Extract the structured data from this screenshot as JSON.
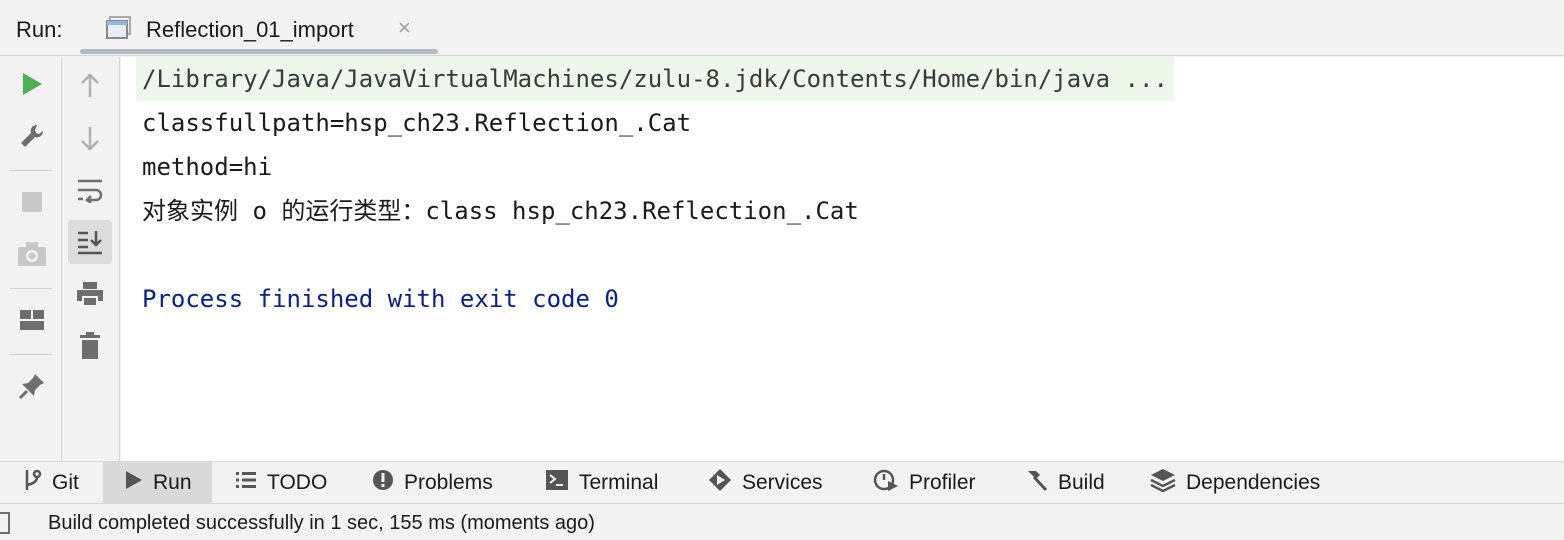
{
  "run_header": {
    "label": "Run:",
    "tab_title": "Reflection_01_import",
    "tab_close": "×"
  },
  "left_toolbar": {
    "items": [
      "rerun-icon",
      "wrench-icon",
      "stop-icon",
      "camera-icon",
      "layout-icon",
      "pin-icon"
    ]
  },
  "console_toolbar": {
    "items": [
      "arrow-up-icon",
      "arrow-down-icon",
      "soft-wrap-icon",
      "scroll-to-end-icon",
      "print-icon",
      "trash-icon"
    ]
  },
  "console": {
    "command_line": "/Library/Java/JavaVirtualMachines/zulu-8.jdk/Contents/Home/bin/java ...",
    "line1": "classfullpath=hsp_ch23.Reflection_.Cat",
    "line2": "method=hi",
    "line3": "对象实例 o 的运行类型：class hsp_ch23.Reflection_.Cat",
    "exit_line": "Process finished with exit code 0"
  },
  "bottom_toolbar": {
    "git": "Git",
    "run": "Run",
    "todo": "TODO",
    "problems": "Problems",
    "terminal": "Terminal",
    "services": "Services",
    "profiler": "Profiler",
    "build": "Build",
    "dependencies": "Dependencies"
  },
  "status_bar": {
    "message": "Build completed successfully in 1 sec, 155 ms (moments ago)"
  },
  "colors": {
    "run_green": "#4caf50",
    "exit_text": "#0b1e8f",
    "command_bg": "#edf7ea"
  }
}
